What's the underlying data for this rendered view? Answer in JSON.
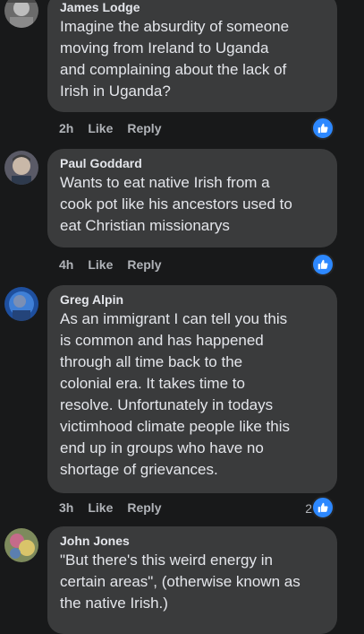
{
  "comments": [
    {
      "author": "James Lodge",
      "lines": [
        "Imagine the absurdity of someone",
        "moving from Ireland to Uganda",
        "and complaining about the lack of",
        "Irish in Uganda?"
      ],
      "time": "2h",
      "like": "Like",
      "reply": "Reply",
      "likes": ""
    },
    {
      "author": "Paul Goddard",
      "lines": [
        "Wants to eat native Irish from a",
        "cook pot like his ancestors used to",
        "eat Christian missionarys"
      ],
      "time": "4h",
      "like": "Like",
      "reply": "Reply",
      "likes": ""
    },
    {
      "author": "Greg Alpin",
      "lines": [
        "As an immigrant I can tell you this",
        "is common and has happened",
        "through all time back to the",
        "colonial era. It takes time to",
        "resolve. Unfortunately in todays",
        "victimhood climate people like this",
        "end up in groups who have no",
        "shortage of grievances."
      ],
      "time": "3h",
      "like": "Like",
      "reply": "Reply",
      "likes": "2"
    },
    {
      "author": "John Jones",
      "lines": [
        "\"But there's this weird energy in",
        "certain areas\", (otherwise known as",
        "the native Irish.)"
      ]
    }
  ],
  "icons": {
    "like_reaction": "thumbs-up-icon",
    "accent": "#2d88ff"
  }
}
